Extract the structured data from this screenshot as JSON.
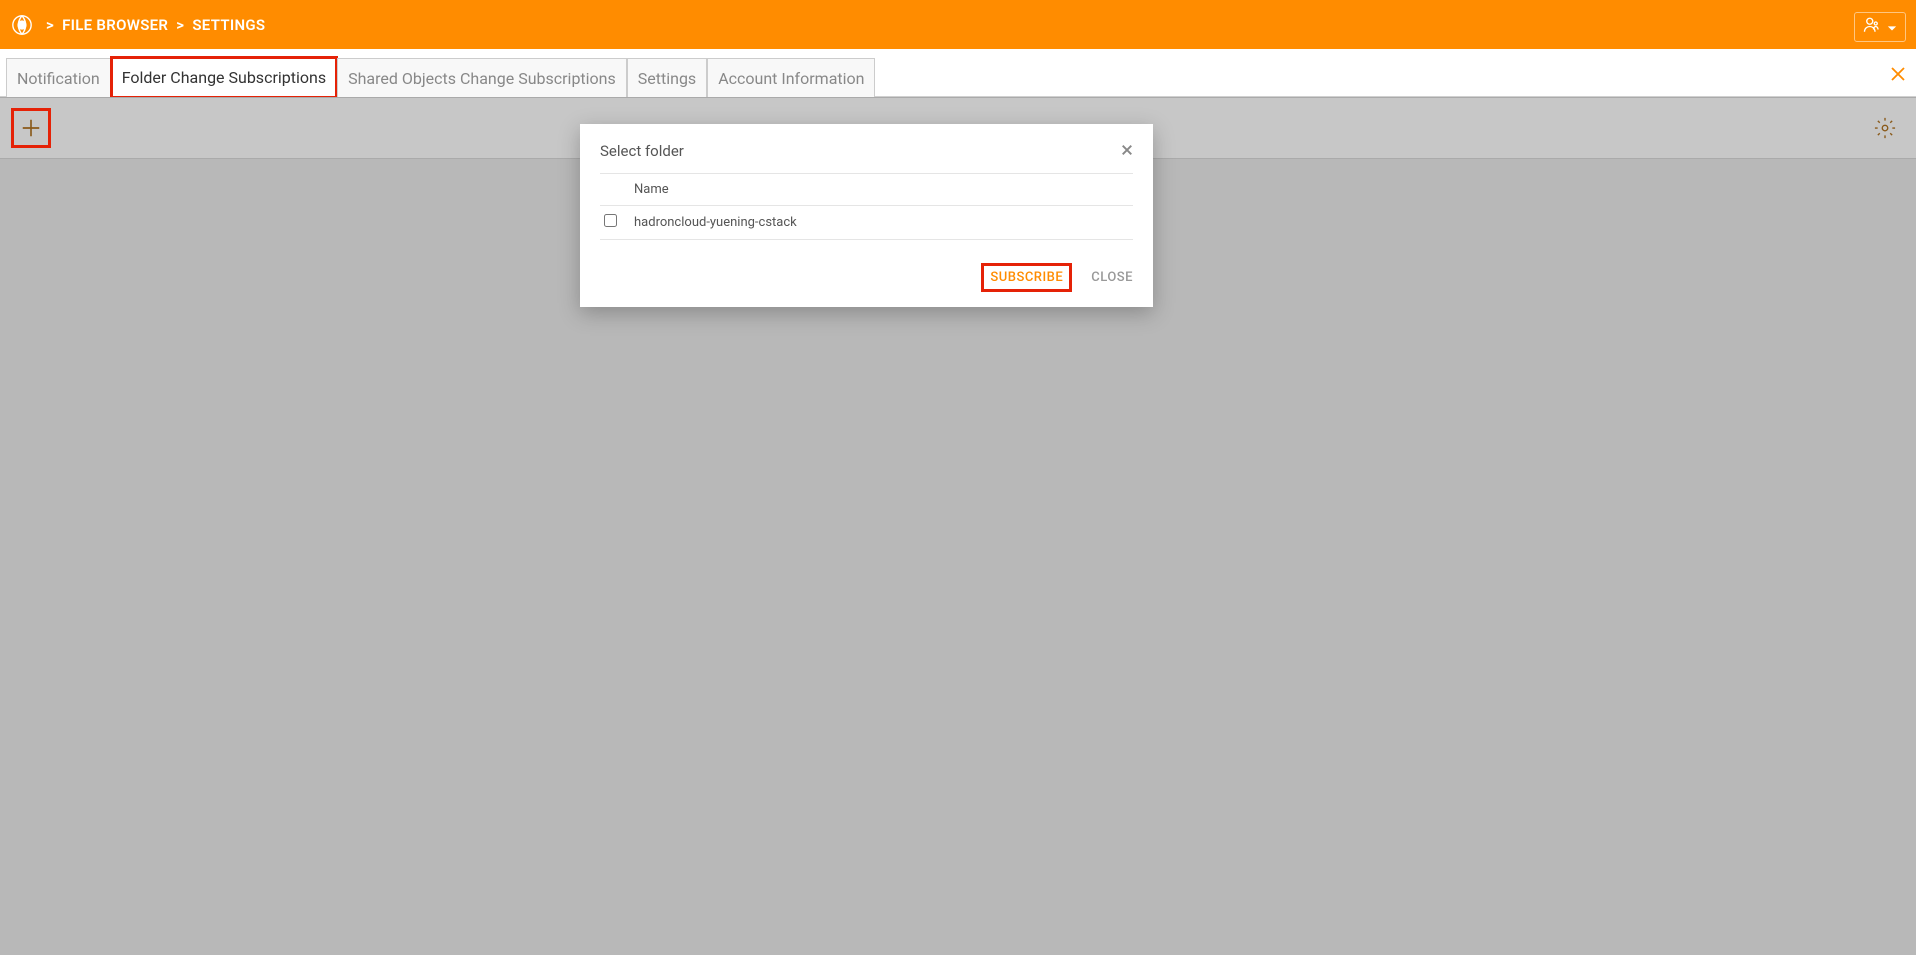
{
  "header": {
    "breadcrumb": {
      "sep": ">",
      "item1": "FILE BROWSER",
      "item2": "SETTINGS"
    }
  },
  "tabs": {
    "notification": "Notification",
    "folder_change": "Folder Change Subscriptions",
    "shared_objects": "Shared Objects Change Subscriptions",
    "settings": "Settings",
    "account_info": "Account Information"
  },
  "modal": {
    "title": "Select folder",
    "column_name": "Name",
    "folders": [
      {
        "name": "hadroncloud-yuening-cstack"
      }
    ],
    "subscribe_label": "SUBSCRIBE",
    "close_label": "CLOSE"
  }
}
